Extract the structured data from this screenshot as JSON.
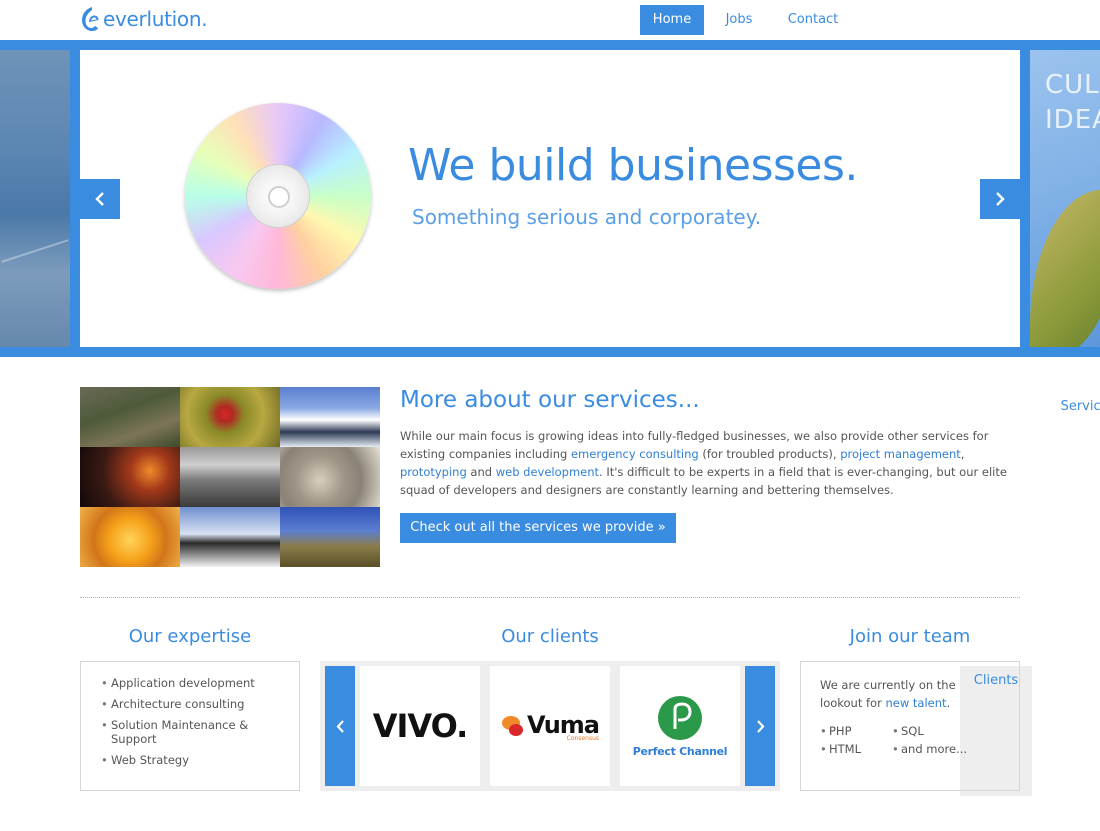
{
  "brand": {
    "name": "everlution.",
    "accent": "#3a8ce0"
  },
  "nav": {
    "items": [
      {
        "label": "Home",
        "active": true
      },
      {
        "label": "Services",
        "active": false
      },
      {
        "label": "Clients",
        "active": false
      },
      {
        "label": "Jobs",
        "active": false
      },
      {
        "label": "Contact",
        "active": false
      }
    ]
  },
  "hero": {
    "title": "We build businesses.",
    "subtitle": "Something serious and corporatey.",
    "next_slide_text": "CULTURE IDEAS"
  },
  "services": {
    "heading": "More about our services...",
    "paragraph": {
      "part1": "While our main focus is growing ideas into fully-fledged businesses, we also provide other services for existing companies including ",
      "link1": "emergency consulting",
      "part2": " (for troubled products), ",
      "link2": "project management",
      "part3": ", ",
      "link3": "prototyping",
      "part4": " and ",
      "link4": "web development",
      "part5": ". It's difficult to be experts in a field that is ever-changing, but our elite squad of developers and designers are constantly learning and bettering themselves."
    },
    "button_label": "Check out all the services we provide »"
  },
  "expertise": {
    "heading": "Our expertise",
    "items": [
      "Application development",
      "Architecture consulting",
      "Solution Maintenance & Support",
      "Web Strategy"
    ]
  },
  "clients": {
    "heading": "Our clients",
    "logos": [
      {
        "name": "vivo",
        "text": "VIVO."
      },
      {
        "name": "vuma",
        "text": "Vuma",
        "subtext": "Consensus"
      },
      {
        "name": "perfect-channel",
        "text": "Perfect Channel"
      }
    ]
  },
  "team": {
    "heading": "Join our team",
    "intro": "We are currently on the lookout for ",
    "link": "new talent",
    "intro_end": ".",
    "skills": [
      "PHP",
      "SQL",
      "HTML",
      "and more..."
    ]
  }
}
